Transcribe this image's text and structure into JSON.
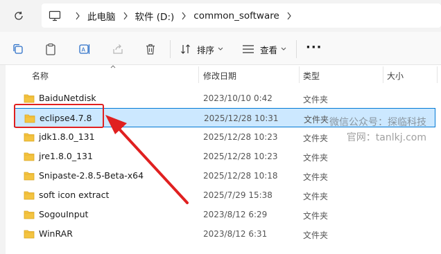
{
  "address": {
    "crumbs": [
      "此电脑",
      "软件 (D:)",
      "common_software"
    ]
  },
  "toolbar": {
    "sort_label": "排序",
    "view_label": "查看",
    "more_label": "···"
  },
  "columns": {
    "name": "名称",
    "modified": "修改日期",
    "type": "类型",
    "size": "大小"
  },
  "files": [
    {
      "name": "BaiduNetdisk",
      "modified": "2023/10/10 0:42",
      "type": "文件夹"
    },
    {
      "name": "eclipse4.7.8",
      "modified": "2025/12/28 10:31",
      "type": "文件夹"
    },
    {
      "name": "jdk1.8.0_131",
      "modified": "2025/12/28 10:23",
      "type": "文件夹"
    },
    {
      "name": "jre1.8.0_131",
      "modified": "2025/12/28 10:23",
      "type": "文件夹"
    },
    {
      "name": "Snipaste-2.8.5-Beta-x64",
      "modified": "2025/12/28 10:18",
      "type": "文件夹"
    },
    {
      "name": "soft icon extract",
      "modified": "2025/7/29 15:38",
      "type": "文件夹"
    },
    {
      "name": "SogouInput",
      "modified": "2023/8/12 6:29",
      "type": "文件夹"
    },
    {
      "name": "WinRAR",
      "modified": "2023/8/12 6:31",
      "type": "文件夹"
    }
  ],
  "selected_index": 1,
  "watermark": {
    "line1": "微信公众号：探临科技",
    "line2": "官网：tanlkj.com"
  },
  "colors": {
    "accent": "#0078d4",
    "selection": "#cce8ff",
    "annotation": "#e02020",
    "folder": "#f4c441"
  }
}
